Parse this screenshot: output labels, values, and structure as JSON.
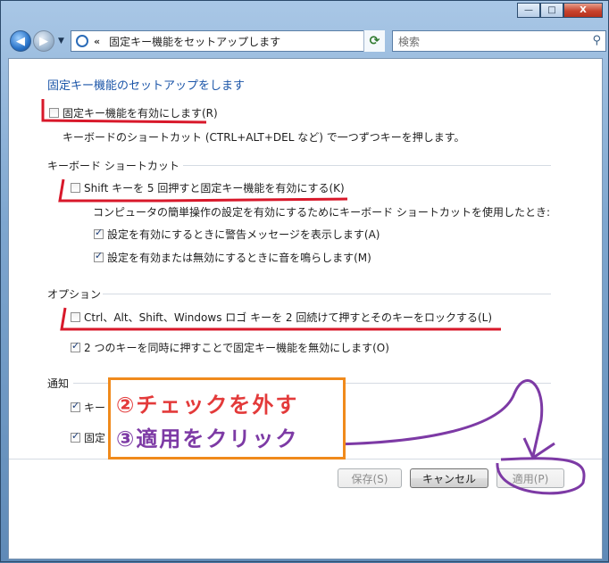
{
  "window": {
    "minimize": "—",
    "maximize": "□",
    "close": "X"
  },
  "address": {
    "chevrons": "«",
    "path": "固定キー機能をセットアップします",
    "search_placeholder": "検索"
  },
  "page": {
    "heading": "固定キー機能のセットアップをします",
    "enable_sticky": {
      "label": "固定キー機能を有効にします(R)",
      "checked": false
    },
    "enable_desc": "キーボードのショートカット (CTRL+ALT+DEL など) で一つずつキーを押します。",
    "shortcut_group": "キーボード ショートカット",
    "shift5": {
      "label": "Shift キーを 5 回押すと固定キー機能を有効にする(K)",
      "checked": false
    },
    "shortcut_desc": "コンピュータの簡単操作の設定を有効にするためにキーボード ショートカットを使用したとき:",
    "warn_msg": {
      "label": "設定を有効にするときに警告メッセージを表示します(A)",
      "checked": true
    },
    "sound_msg": {
      "label": "設定を有効または無効にするときに音を鳴らします(M)",
      "checked": true
    },
    "options_group": "オプション",
    "lock_keys": {
      "label": "Ctrl、Alt、Shift、Windows ロゴ キーを 2 回続けて押すとそのキーをロックする(L)",
      "checked": false
    },
    "two_keys": {
      "label": "2 つのキーを同時に押すことで固定キー機能を無効にします(O)",
      "checked": true
    },
    "notify_group": "通知",
    "notify1": {
      "label": "キー",
      "checked": true
    },
    "notify2": {
      "label": "固定",
      "checked": true
    }
  },
  "buttons": {
    "save": "保存(S)",
    "cancel": "キャンセル",
    "apply": "適用(P)"
  },
  "annotation": {
    "step2": "②チェックを外す",
    "step3": "③適用をクリック"
  },
  "colors": {
    "red_mark": "#d8182a",
    "purple_mark": "#7d3aa5",
    "orange_box": "#f08a1c"
  }
}
